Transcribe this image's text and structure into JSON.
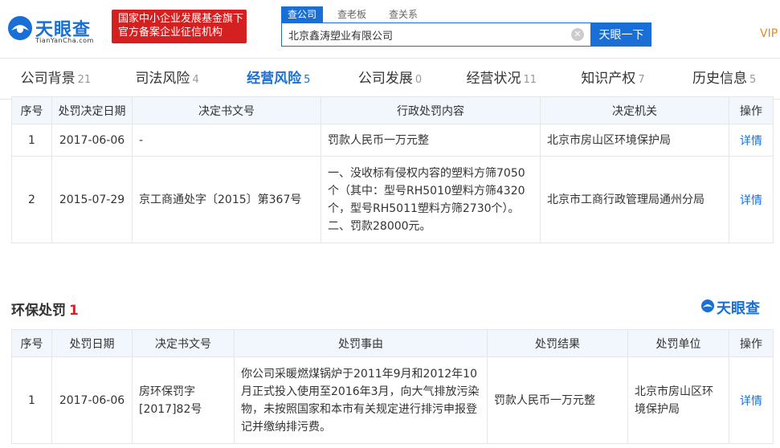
{
  "header": {
    "logo_text": "天眼查",
    "logo_sub": "TianYanCha.com",
    "badge_line1": "国家中小企业发展基金旗下",
    "badge_line2": "官方备案企业征信机构",
    "search_tabs": [
      "查公司",
      "查老板",
      "查关系"
    ],
    "search_value": "北京鑫涛塑业有限公司",
    "search_button": "天眼一下",
    "vip": "VIP"
  },
  "nav": [
    {
      "label": "公司背景",
      "count": "21"
    },
    {
      "label": "司法风险",
      "count": "4"
    },
    {
      "label": "经营风险",
      "count": "5"
    },
    {
      "label": "公司发展",
      "count": "0"
    },
    {
      "label": "经营状况",
      "count": "11"
    },
    {
      "label": "知识产权",
      "count": "7"
    },
    {
      "label": "历史信息",
      "count": "5"
    }
  ],
  "admin_penalty": {
    "headers": [
      "序号",
      "处罚决定日期",
      "决定书文号",
      "行政处罚内容",
      "决定机关",
      "操作"
    ],
    "rows": [
      {
        "no": "1",
        "date": "2017-06-06",
        "doc": "-",
        "content": "罚款人民币一万元整",
        "authority": "北京市房山区环境保护局",
        "action": "详情"
      },
      {
        "no": "2",
        "date": "2015-07-29",
        "doc": "京工商通处字〔2015〕第367号",
        "content": "一、没收标有侵权内容的塑料方筛7050个（其中：型号RH5010塑料方筛4320个，型号RH5011塑料方筛2730个）。二、罚款28000元。",
        "authority": "北京市工商行政管理局通州分局",
        "action": "详情"
      }
    ]
  },
  "env_penalty": {
    "title": "环保处罚",
    "count": "1",
    "watermark": "天眼查",
    "headers": [
      "序号",
      "处罚日期",
      "决定书文号",
      "处罚事由",
      "处罚结果",
      "处罚单位",
      "操作"
    ],
    "rows": [
      {
        "no": "1",
        "date": "2017-06-06",
        "doc": "房环保罚字[2017]82号",
        "reason": "你公司采暖燃煤锅炉于2011年9月和2012年10月正式投入使用至2016年3月，向大气排放污染物，未按照国家和本市有关规定进行排污申报登记并缴纳排污费。",
        "result": "罚款人民币一万元整",
        "unit": "北京市房山区环境保护局",
        "action": "详情"
      }
    ]
  },
  "colors": {
    "brand": "#1a6fd6",
    "badge": "#d42020",
    "header_bg": "#f2f7fd",
    "count_red": "#e02020"
  }
}
